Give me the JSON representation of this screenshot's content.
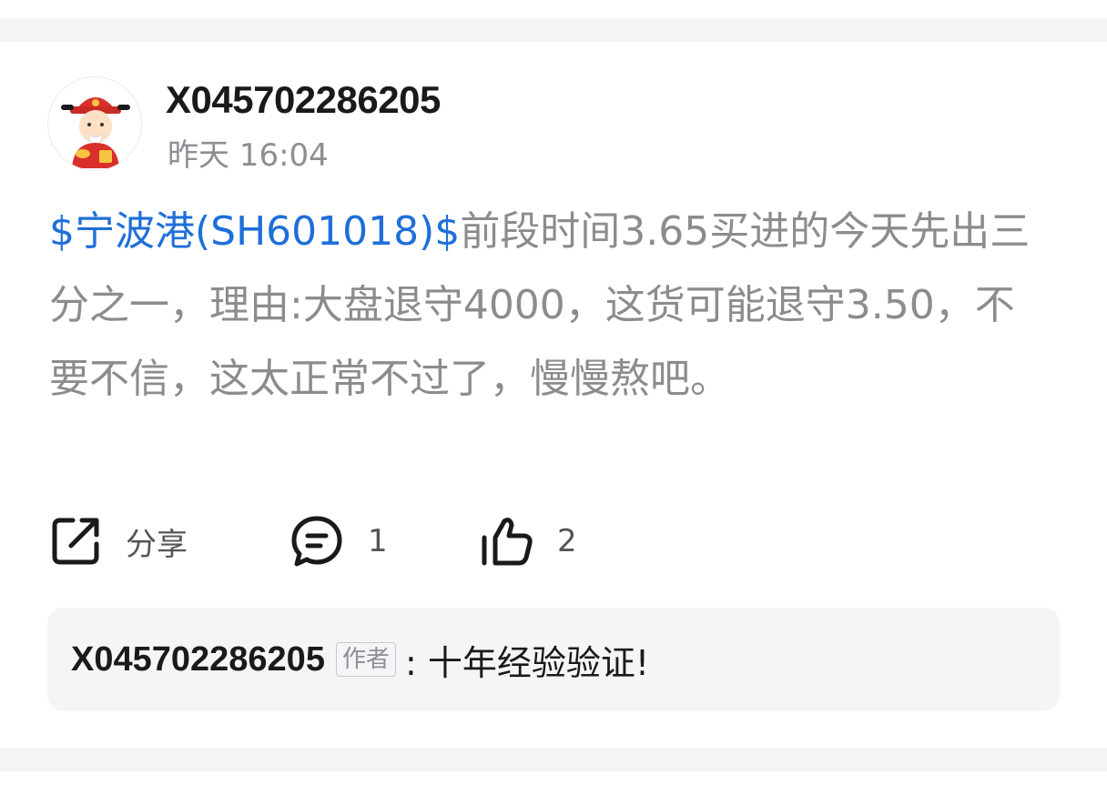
{
  "post": {
    "username": "X045702286205",
    "timestamp": "昨天 16:04",
    "stock_tag": "$宁波港(SH601018)$",
    "body": "前段时间3.65买进的今天先出三分之一，理由:大盘退守4000，这货可能退守3.50，不要不信，这太正常不过了，慢慢熬吧。",
    "link_color": "#1e6fd9"
  },
  "actions": {
    "share_label": "分享",
    "comment_count": "1",
    "like_count": "2"
  },
  "reply": {
    "username": "X045702286205",
    "author_badge": "作者",
    "text": ": 十年经验验证!"
  },
  "icons": [
    "avatar-cartoon",
    "share-icon",
    "comment-icon",
    "thumbs-up-icon"
  ]
}
